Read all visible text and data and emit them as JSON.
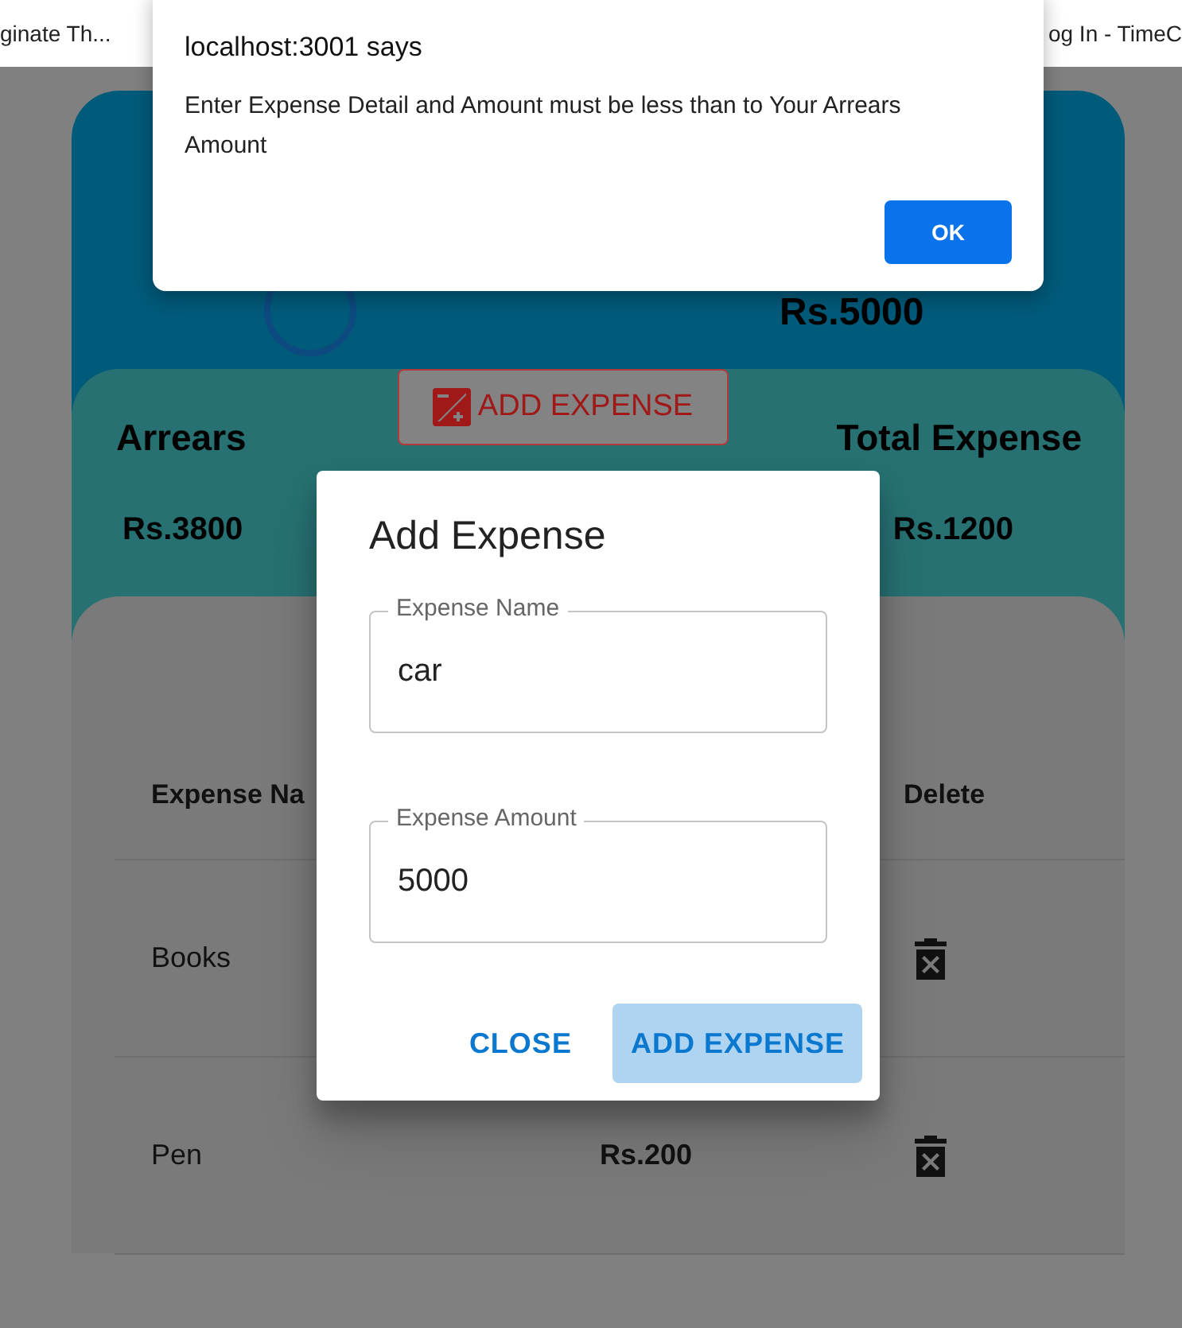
{
  "browser_tabs": [
    {
      "title": "ginate Th..."
    },
    {
      "title": "og In - TimeC"
    }
  ],
  "summary": {
    "budget_value": "Rs.5000",
    "arrears_label": "Arrears",
    "arrears_value": "Rs.3800",
    "total_expense_label": "Total Expense",
    "total_expense_value": "Rs.1200",
    "add_button": "ADD EXPENSE"
  },
  "table": {
    "columns": [
      {
        "label": "Expense Na",
        "kind": "name"
      },
      {
        "label": "Delete",
        "kind": "delete"
      }
    ],
    "rows": [
      {
        "name": "Books"
      },
      {
        "name": "Pen",
        "amount": "Rs.200"
      }
    ]
  },
  "dialog": {
    "title": "Add Expense",
    "fields": [
      {
        "label": "Expense Name",
        "value": "car"
      },
      {
        "label": "Expense Amount",
        "value": "5000"
      }
    ],
    "buttons": [
      {
        "label": "CLOSE",
        "kind": "text"
      },
      {
        "label": "ADD EXPENSE",
        "kind": "contained"
      }
    ]
  },
  "alert": {
    "title": "localhost:3001 says",
    "message": "Enter Expense Detail and Amount must be less than to Your Arrears Amount",
    "button": "OK"
  }
}
